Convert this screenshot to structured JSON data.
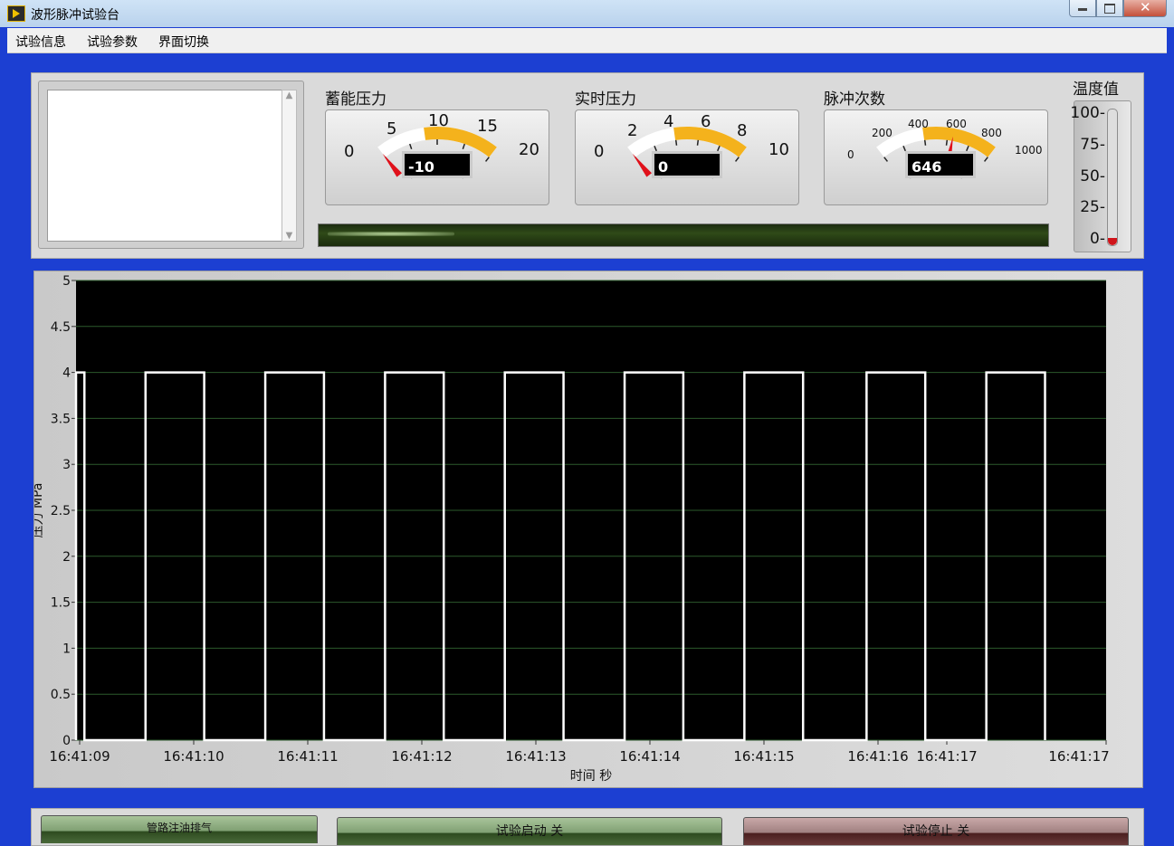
{
  "window": {
    "title": "波形脉冲试验台"
  },
  "menu": {
    "items": [
      "试验信息",
      "试验参数",
      "界面切换"
    ]
  },
  "gauges": [
    {
      "label": "蓄能压力",
      "ticks": [
        "0",
        "5",
        "10",
        "15",
        "20"
      ],
      "min": 0,
      "max": 20,
      "value": -10,
      "display": "-10"
    },
    {
      "label": "实时压力",
      "ticks": [
        "0",
        "2",
        "4",
        "6",
        "8",
        "10"
      ],
      "min": 0,
      "max": 10,
      "value": 0,
      "display": "0"
    },
    {
      "label": "脉冲次数",
      "ticks": [
        "0",
        "200",
        "400",
        "600",
        "800",
        "1000"
      ],
      "min": 0,
      "max": 1000,
      "value": 646,
      "display": "646"
    }
  ],
  "thermometer": {
    "label": "温度值",
    "ticks": [
      "100-",
      "75-",
      "50-",
      "25-",
      "0-"
    ],
    "value": 0
  },
  "chart_data": {
    "type": "line",
    "title": "",
    "xlabel": "时间 秒",
    "ylabel": "压力 MPa",
    "ylim": [
      0,
      5
    ],
    "yticks": [
      "5",
      "4.5",
      "4",
      "3.5",
      "3",
      "2.5",
      "2",
      "1.5",
      "1",
      "0.5",
      "0"
    ],
    "xticks": [
      "16:41:09",
      "16:41:10",
      "16:41:11",
      "16:41:12",
      "16:41:13",
      "16:41:14",
      "16:41:15",
      "16:41:16",
      "16:41:17",
      "16:41:17"
    ],
    "grid": true,
    "series": [
      {
        "pulses": [
          [
            0.0,
            0.07
          ],
          [
            0.58,
            1.07
          ],
          [
            1.58,
            2.07
          ],
          [
            2.58,
            3.07
          ],
          [
            3.58,
            4.07
          ],
          [
            4.58,
            5.07
          ],
          [
            5.58,
            6.07
          ],
          [
            6.6,
            7.09
          ],
          [
            7.6,
            8.09
          ]
        ],
        "high": 4,
        "low": 0,
        "xrange": [
          0,
          8.6
        ]
      }
    ]
  },
  "buttons": {
    "fill": "管路注油排气",
    "start": "试验启动 关",
    "stop": "试验停止 关"
  }
}
